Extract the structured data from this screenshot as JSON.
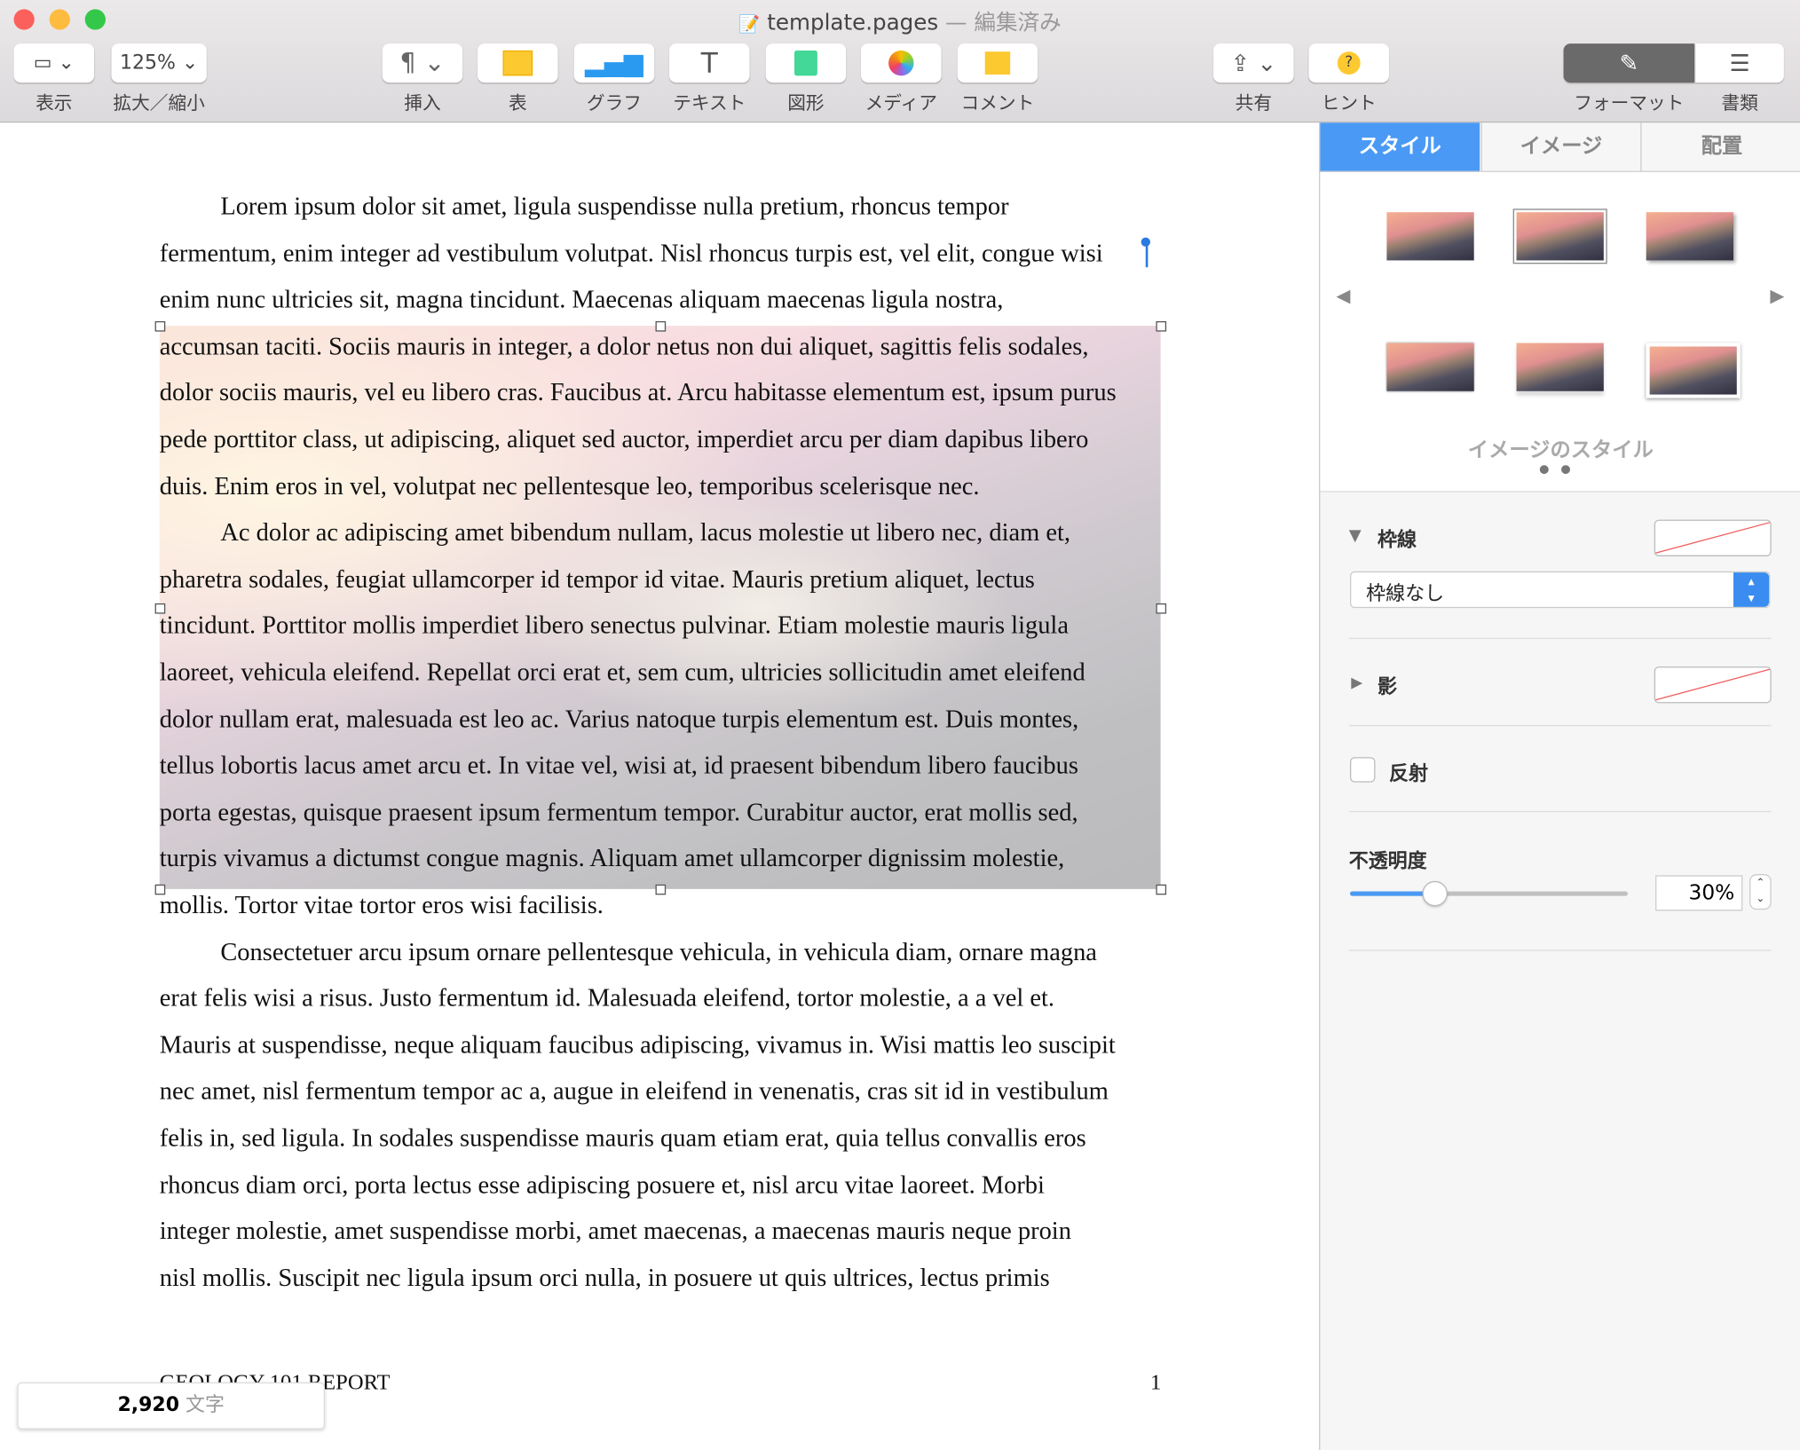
{
  "window": {
    "title": "template.pages",
    "edited": "— 編集済み"
  },
  "toolbar": {
    "view": "表示",
    "zoom_value": "125%",
    "zoom": "拡大／縮小",
    "insert": "挿入",
    "table": "表",
    "chart": "グラフ",
    "text": "テキスト",
    "shape": "図形",
    "media": "メディア",
    "comment": "コメント",
    "share": "共有",
    "tips": "ヒント",
    "format": "フォーマット",
    "document": "書類"
  },
  "document": {
    "lines": [
      "Lorem ipsum dolor sit amet, ligula suspendisse nulla pretium, rhoncus tempor",
      "fermentum, enim integer ad vestibulum volutpat. Nisl rhoncus turpis est, vel elit, congue wisi",
      "enim nunc ultricies sit, magna tincidunt. Maecenas aliquam maecenas ligula nostra,",
      "accumsan taciti. Sociis mauris in integer, a dolor netus non dui aliquet, sagittis felis sodales,",
      "dolor sociis mauris, vel eu libero cras. Faucibus at. Arcu habitasse elementum est, ipsum purus",
      "pede porttitor class, ut adipiscing, aliquet sed auctor, imperdiet arcu per diam dapibus libero",
      "duis. Enim eros in vel, volutpat nec pellentesque leo, temporibus scelerisque nec.",
      "Ac dolor ac adipiscing amet bibendum nullam, lacus molestie ut libero nec, diam et,",
      "pharetra sodales, feugiat ullamcorper id tempor id vitae. Mauris pretium aliquet, lectus",
      "tincidunt. Porttitor mollis imperdiet libero senectus pulvinar. Etiam molestie mauris ligula",
      "laoreet, vehicula eleifend. Repellat orci erat et, sem cum, ultricies sollicitudin amet eleifend",
      "dolor nullam erat, malesuada est leo ac. Varius natoque turpis elementum est. Duis montes,",
      "tellus lobortis lacus amet arcu et. In vitae vel, wisi at, id praesent bibendum libero faucibus",
      "porta egestas, quisque praesent ipsum fermentum tempor. Curabitur auctor, erat mollis sed,",
      "turpis vivamus a dictumst congue magnis. Aliquam amet ullamcorper dignissim molestie,",
      "mollis. Tortor vitae tortor eros wisi facilisis.",
      "Consectetuer arcu ipsum ornare pellentesque vehicula, in vehicula diam, ornare magna",
      "erat felis wisi a risus. Justo fermentum id. Malesuada eleifend, tortor molestie, a a vel et.",
      "Mauris at suspendisse, neque aliquam faucibus adipiscing, vivamus in. Wisi mattis leo suscipit",
      "nec amet, nisl fermentum tempor ac a, augue in eleifend in venenatis, cras sit id in vestibulum",
      "felis in, sed ligula. In sodales suspendisse mauris quam etiam erat, quia tellus convallis eros",
      "rhoncus diam orci, porta lectus esse adipiscing posuere et, nisl arcu vitae laoreet. Morbi",
      "integer molestie, amet suspendisse morbi, amet maecenas, a maecenas mauris neque proin",
      "nisl mollis. Suscipit nec ligula ipsum orci nulla, in posuere ut quis ultrices, lectus primis"
    ],
    "footer_title": "GEOLOGY 101 REPORT",
    "page_number": "1",
    "word_count": "2,920",
    "word_count_unit": "文字"
  },
  "sidebar": {
    "tabs": [
      "スタイル",
      "イメージ",
      "配置"
    ],
    "image_styles_label": "イメージのスタイル",
    "border_label": "枠線",
    "border_value": "枠線なし",
    "shadow_label": "影",
    "reflection_label": "反射",
    "reflection_checked": false,
    "opacity_label": "不透明度",
    "opacity_value": "30%",
    "opacity": 30,
    "accent": "#4a9af5"
  }
}
